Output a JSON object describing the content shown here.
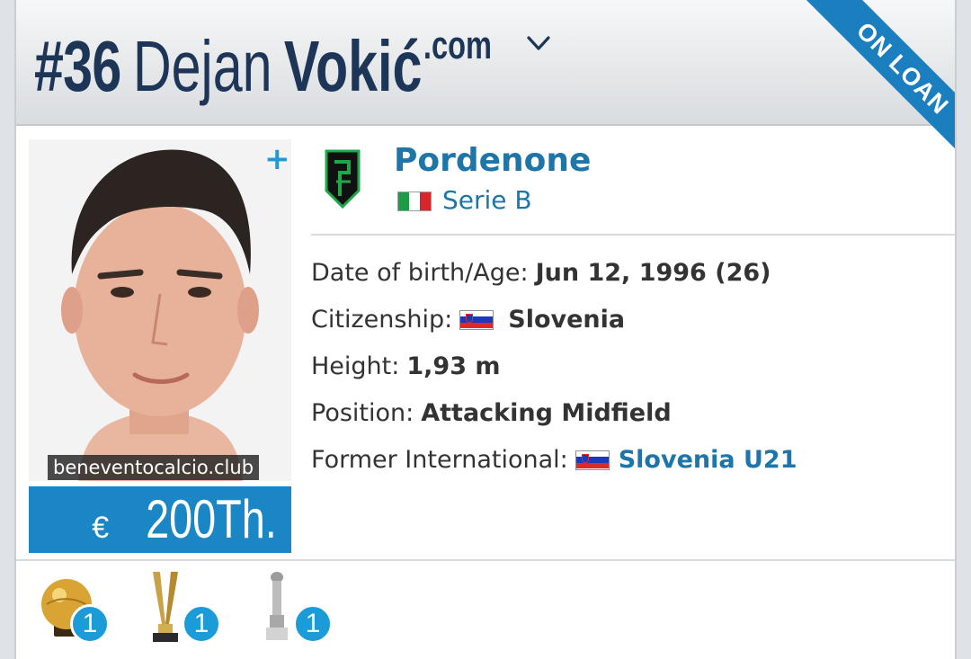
{
  "player": {
    "number": "#36",
    "first_name": "Dejan",
    "last_name": "Vokić",
    "suffix": ".com"
  },
  "ribbon": "ON LOAN",
  "photo_credit": "beneventocalcio.club",
  "market_value": {
    "currency": "€",
    "amount": "200Th."
  },
  "club": {
    "name": "Pordenone",
    "league": "Serie B"
  },
  "info": {
    "dob_label": "Date of birth/Age:",
    "dob_value": "Jun 12, 1996 (26)",
    "citizenship_label": "Citizenship:",
    "citizenship_value": "Slovenia",
    "height_label": "Height:",
    "height_value": "1,93 m",
    "position_label": "Position:",
    "position_value": "Attacking Midfield",
    "international_label": "Former International:",
    "international_value": "Slovenia U21"
  },
  "trophies": [
    {
      "icon": "golden-ball-icon",
      "count": "1"
    },
    {
      "icon": "cup-trophy-icon",
      "count": "1"
    },
    {
      "icon": "silver-trophy-icon",
      "count": "1"
    }
  ],
  "colors": {
    "accent": "#1a86c6",
    "link": "#1d75a8",
    "title": "#1d3557"
  }
}
